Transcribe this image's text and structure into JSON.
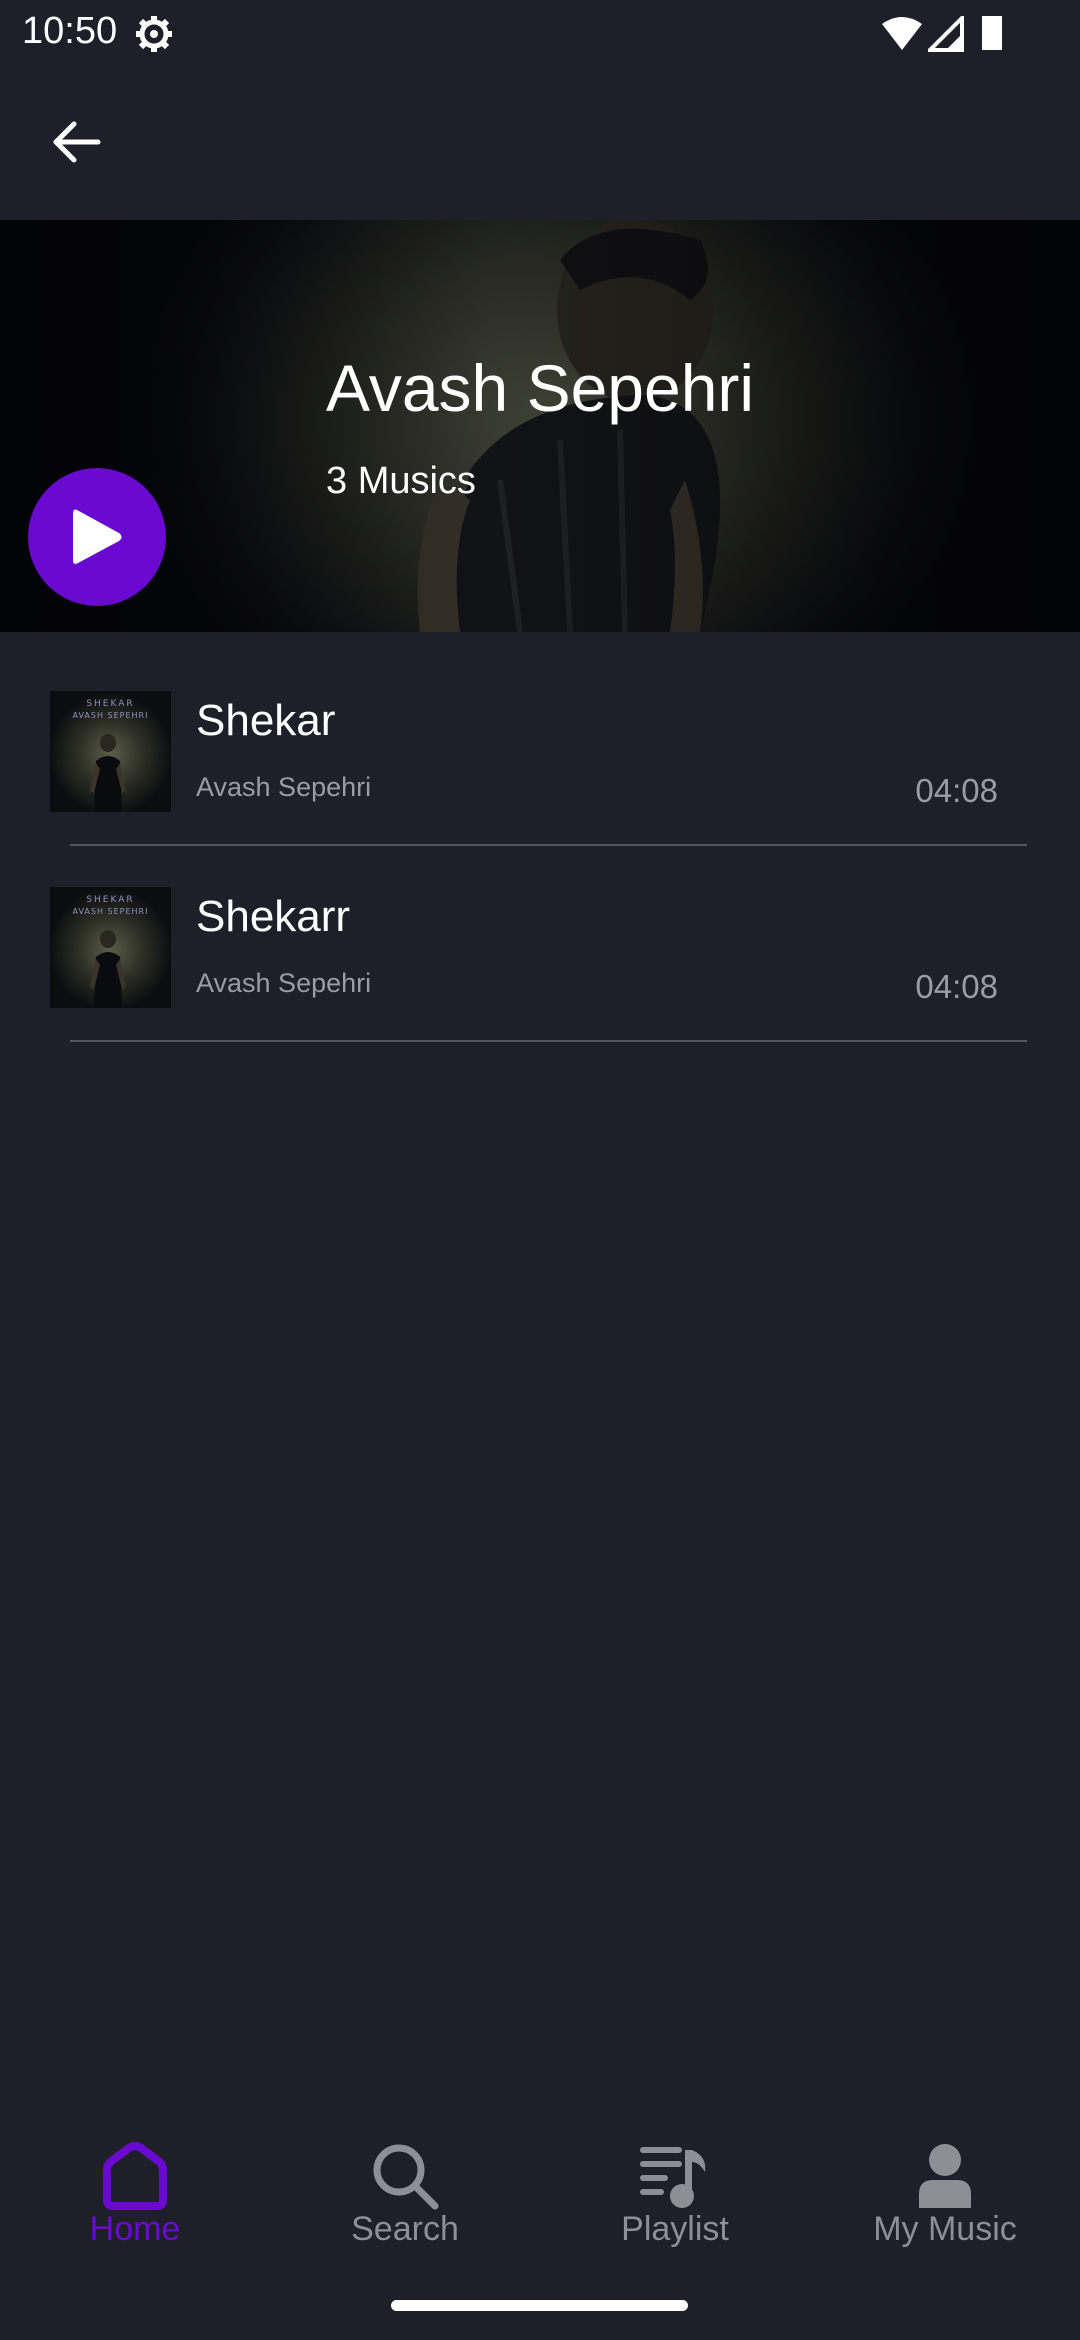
{
  "status_bar": {
    "time": "10:50",
    "icons": [
      "gear-icon",
      "wifi-icon",
      "signal-icon",
      "battery-icon"
    ]
  },
  "app_bar": {
    "back_icon": "arrow-left-icon"
  },
  "artist": {
    "name": "Avash Sepehri",
    "track_count": "3 Musics",
    "play_icon": "play-icon",
    "accent_color": "#6a0ad0"
  },
  "tracks": [
    {
      "title": "Shekar",
      "artist": "Avash Sepehri",
      "duration": "04:08",
      "cover_text_top": "SHEKAR",
      "cover_text_bottom": "AVASH SEPEHRI"
    },
    {
      "title": "Shekarr",
      "artist": "Avash Sepehri",
      "duration": "04:08",
      "cover_text_top": "SHEKAR",
      "cover_text_bottom": "AVASH SEPEHRI"
    }
  ],
  "bottom_nav": {
    "active": "Home",
    "items": [
      {
        "label": "Home",
        "icon": "home-icon"
      },
      {
        "label": "Search",
        "icon": "search-icon"
      },
      {
        "label": "Playlist",
        "icon": "playlist-icon"
      },
      {
        "label": "My Music",
        "icon": "person-icon"
      }
    ]
  },
  "colors": {
    "background": "#1e1f28",
    "accent": "#6a0ad0",
    "muted_text": "#9b9ca3",
    "inactive_nav": "#8e8f96"
  }
}
